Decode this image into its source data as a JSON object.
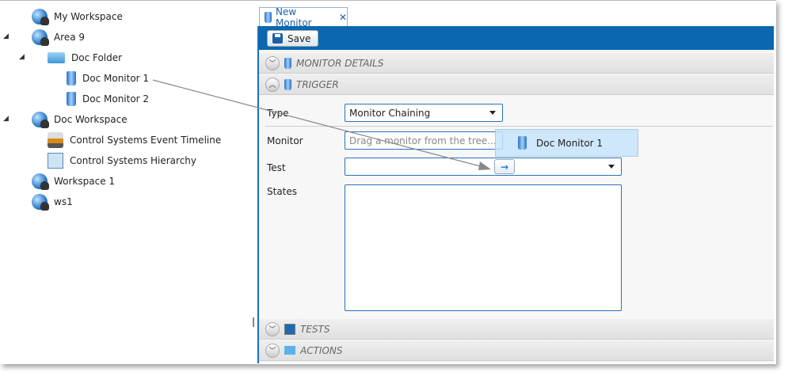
{
  "tree": {
    "items": [
      {
        "label": "My Workspace",
        "icon": "workspace-icon"
      },
      {
        "label": "Area 9",
        "icon": "workspace-icon",
        "expanded": true
      },
      {
        "label": "Doc Folder",
        "icon": "folder-icon",
        "expanded": true
      },
      {
        "label": "Doc Monitor 1",
        "icon": "monitor-icon"
      },
      {
        "label": "Doc Monitor 2",
        "icon": "monitor-icon"
      },
      {
        "label": "Doc Workspace",
        "icon": "workspace-icon",
        "expanded": true
      },
      {
        "label": "Control Systems Event Timeline",
        "icon": "timeline-icon"
      },
      {
        "label": "Control Systems Hierarchy",
        "icon": "hierarchy-icon"
      },
      {
        "label": "Workspace 1",
        "icon": "workspace-icon"
      },
      {
        "label": "ws1",
        "icon": "workspace-icon"
      }
    ]
  },
  "tab": {
    "label": "New Monitor",
    "close": "✕"
  },
  "toolbar": {
    "save_label": "Save"
  },
  "sections": {
    "monitor_details": "MONITOR DETAILS",
    "trigger": "TRIGGER",
    "tests": "TESTS",
    "actions": "ACTIONS"
  },
  "form": {
    "type_label": "Type",
    "type_value": "Monitor Chaining",
    "monitor_label": "Monitor",
    "monitor_placeholder": "Drag a monitor from the tree...",
    "test_label": "Test",
    "test_value": "",
    "states_label": "States"
  },
  "drag": {
    "ghost_label": "Doc Monitor 1",
    "arrow_glyph": "→"
  },
  "colors": {
    "accent": "#0a67b0"
  }
}
